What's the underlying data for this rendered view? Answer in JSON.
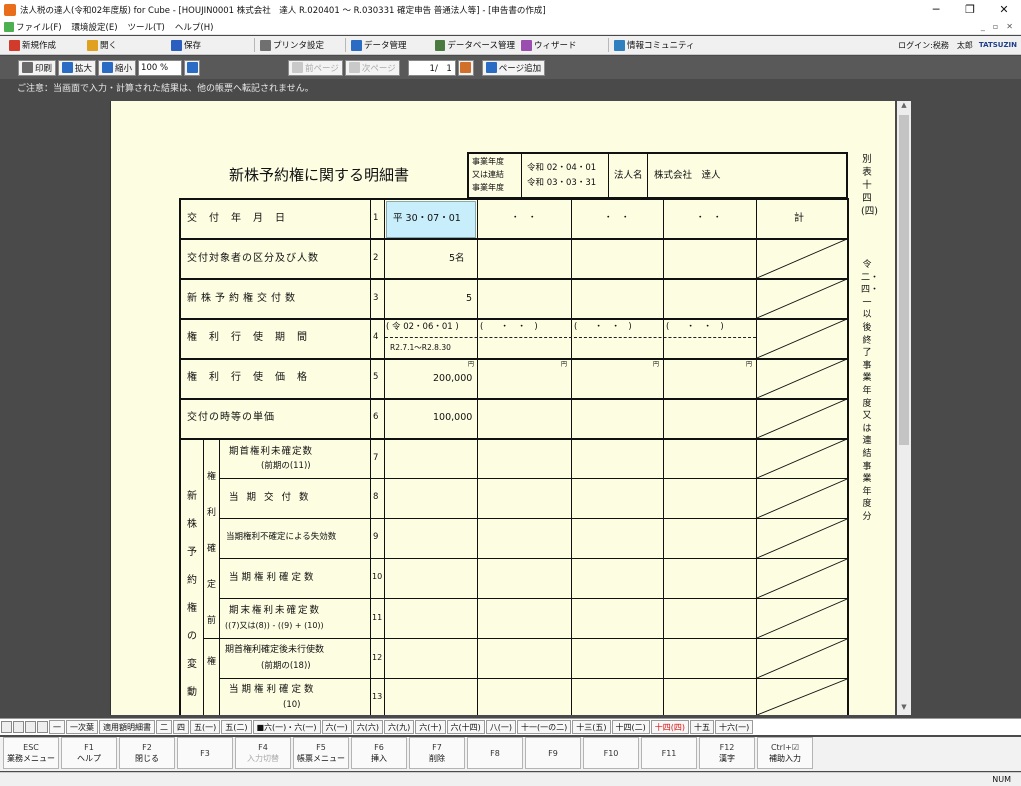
{
  "window": {
    "title": "法人税の達人(令和02年度版) for Cube - [HOUJIN0001 株式会社　達人 R.020401 ～ R.030331 確定申告 普通法人等] - [申告書の作成]",
    "minimize": "─",
    "restore": "❐",
    "close": "✕"
  },
  "menu": {
    "items": [
      "ファイル(F)",
      "環境設定(E)",
      "ツール(T)",
      "ヘルプ(H)"
    ],
    "sub_controls": [
      "_",
      "▫",
      "✕"
    ]
  },
  "toolbar": {
    "items": [
      {
        "label": "新規作成",
        "icon": "new-icon",
        "color": "#d23b2b"
      },
      {
        "label": "開く",
        "icon": "open-icon",
        "color": "#e0a020"
      },
      {
        "label": "保存",
        "icon": "save-icon",
        "color": "#2a5fc0"
      },
      {
        "label": "プリンタ設定",
        "icon": "printer-settings-icon",
        "color": "#707070"
      },
      {
        "label": "データ管理",
        "icon": "data-management-icon",
        "color": "#2a6bc4"
      },
      {
        "label": "データベース管理",
        "icon": "database-icon",
        "color": "#4a7a40"
      },
      {
        "label": "ウィザード",
        "icon": "wizard-icon",
        "color": "#9a4fb0"
      },
      {
        "label": "情報コミュニティ",
        "icon": "community-icon",
        "color": "#3080c0"
      }
    ],
    "login": "ログイン:税務　太郎",
    "brand": "TATSUZIN"
  },
  "preview": {
    "print": "印刷",
    "zoom_in": "拡大",
    "zoom_out": "縮小",
    "zoom_value": "100 %",
    "prev_page": "前ページ",
    "next_page": "次ページ",
    "page_indicator": "1/　1",
    "add_page": "ページ追加"
  },
  "notice": "ご注意：当画面で入力・計算された結果は、他の帳票へ転記されません。",
  "form": {
    "title": "新株予約権に関する明細書",
    "period_label_1": "事業年度",
    "period_label_2": "又は連結",
    "period_label_3": "事業年度",
    "period_from": "令和 02・04・01",
    "period_to": "令和 03・03・31",
    "corp_label": "法人名",
    "corp_name": "株式会社　達人",
    "side_number": "別表十四(四)",
    "side_note": "令二・四・一以後終了事業年度又は連結事業年度分",
    "total_header": "計",
    "rows": [
      {
        "label": "交　付　年　月　日",
        "no": "1",
        "value": "平 30・07・01",
        "blank": "・　・"
      },
      {
        "label": "交付対象者の区分及び人数",
        "no": "2",
        "value": "5名"
      },
      {
        "label": "新株予約権交付数",
        "no": "3",
        "value": "5"
      },
      {
        "label": "権　利　行　使　期　間",
        "no": "4",
        "value": "( 令 02・06・01 )",
        "value_sub": "R2.7.1～R2.8.30",
        "blank": "(　　・　・　)"
      },
      {
        "label": "権　利　行　使　価　格",
        "no": "5",
        "value": "200,000",
        "unit": "円"
      },
      {
        "label": "交付の時等の単価",
        "no": "6",
        "value": "100,000"
      }
    ],
    "section_main": "新株予約権の変動",
    "section_sub_1": "権利確定前",
    "section_sub_2": "権",
    "sub_rows": [
      {
        "label": "期首権利未確定数",
        "label_sub": "(前期の(11))",
        "no": "7"
      },
      {
        "label": "当期交付数",
        "no": "8"
      },
      {
        "label": "当期権利不確定による失効数",
        "no": "9"
      },
      {
        "label": "当期権利確定数",
        "no": "10"
      },
      {
        "label": "期末権利未確定数",
        "label_sub": "((7)又は(8)) - ((9) + (10))",
        "no": "11"
      },
      {
        "label": "期首権利確定後未行使数",
        "label_sub": "(前期の(18))",
        "no": "12"
      },
      {
        "label": "当期権利確定数",
        "label_sub": "(10)",
        "no": "13"
      }
    ]
  },
  "tabs": [
    "一",
    "一次葉",
    "適用額明細書",
    "二",
    "四",
    "五(一)",
    "五(二)",
    "■六(一)・六(一)",
    "六(一)",
    "六(六)",
    "六(九)",
    "六(十)",
    "六(十四)",
    "八(一)",
    "十一(一の二)",
    "十三(五)",
    "十四(二)",
    "十四(四)",
    "十五",
    "十六(一)"
  ],
  "active_tab": "十四(四)",
  "fkeys": [
    {
      "key": "ESC",
      "label": "業務メニュー"
    },
    {
      "key": "F1",
      "label": "ヘルプ"
    },
    {
      "key": "F2",
      "label": "閉じる"
    },
    {
      "key": "F3",
      "label": ""
    },
    {
      "key": "F4",
      "label": "入力切替",
      "disabled": true
    },
    {
      "key": "F5",
      "label": "帳票メニュー"
    },
    {
      "key": "F6",
      "label": "挿入"
    },
    {
      "key": "F7",
      "label": "削除"
    },
    {
      "key": "F8",
      "label": ""
    },
    {
      "key": "F9",
      "label": ""
    },
    {
      "key": "F10",
      "label": ""
    },
    {
      "key": "F11",
      "label": ""
    },
    {
      "key": "F12",
      "label": "漢字"
    },
    {
      "key": "Ctrl+☑",
      "label": "補助入力"
    }
  ],
  "status": {
    "num": "NUM"
  }
}
